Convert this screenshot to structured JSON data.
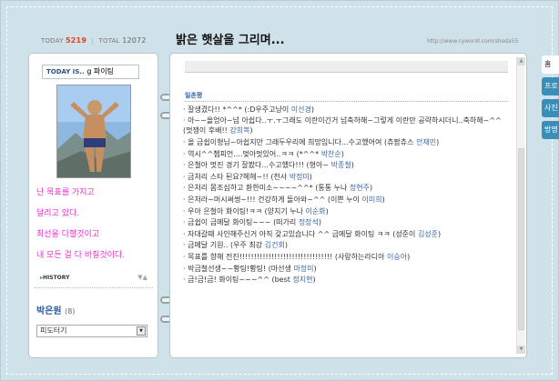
{
  "header": {
    "today_label": "TODAY",
    "today_count": "5219",
    "total_label": "TOTAL",
    "total_count": "12072",
    "title": "밝은 햇살을 그리며...",
    "url": "http://www.cyworld.com/shoda55"
  },
  "left": {
    "today_is_label": "TODAY IS..",
    "today_is_value": "g 파이팅",
    "bio": [
      "난 목표를 가지고",
      "달리고 있다.",
      "최선을 다할것이고",
      "내 모든 걸 다 바칠것이다."
    ],
    "history_label": "HISTORY",
    "history_arrows": "▼▲",
    "owner_name": "박은원",
    "owner_count": "(8)",
    "select_value": "피도터기",
    "select_arrow": "▼"
  },
  "main": {
    "section_title": "일촌평",
    "comments": [
      {
        "text": "· 잘생겼다!! *^^* (:D우주고냥이 ",
        "author": "이선경",
        "tail": ")"
      },
      {
        "text": "· 아~~올엉아~넘 아쉽다..ㅜ.ㅜ그래도 이란이긴거 넘축하해~그렇게 이란만 공략하시더니..축하해~^^ (멋쟁이 후배!! ",
        "author": "강희복",
        "tail": ")"
      },
      {
        "text": "· 올 금쉽이형님~아쉽지만 그래두우리에 희망입니다...수고했어여 (츄팝츄스 ",
        "author": "안재민",
        "tail": ")"
      },
      {
        "text": "· 역시^^챔피언....멎아멋있어..ㅋㅋ (*^^* ",
        "author": "박찬순",
        "tail": ")"
      },
      {
        "text": "· 은철아 멋진 경기 잘봤다...수고했다!!! (형아~ ",
        "author": "박종철",
        "tail": ")"
      },
      {
        "text": "· 금처리 스타 된요?헤헤~!! (천사 ",
        "author": "박정미",
        "tail": ")"
      },
      {
        "text": "· 은처리 몸조심하고 환한미소~~~~^^* (통통 누나 ",
        "author": "정현주",
        "tail": ")"
      },
      {
        "text": "· 은처라~머시써썽~!!! 건강하게 돌아와~^^ (이쁜 누이 ",
        "author": "이미희",
        "tail": ")"
      },
      {
        "text": "· 우아 은철아 화이팅!ㅋㅋ (양치기 누나 ",
        "author": "이순화",
        "tail": ")"
      },
      {
        "text": "· 금쉽이 금메달 화이팅~~~ (떠가리 ",
        "author": "정장석",
        "tail": ")"
      },
      {
        "text": "· 자대갈때 사인해주신거 아직 갖고있습니다 ^^ 금메달 화이팅 ㅋㅋ (성준이 ",
        "author": "김성준",
        "tail": ")"
      },
      {
        "text": "· 금메달 기원.. (우주 최강 ",
        "author": "김건회",
        "tail": ")"
      },
      {
        "text": "· 목표를 향해 전진!!!!!!!!!!!!!!!!!!!!!!!!!!!!!!!! (사랑하는라디아 ",
        "author": "이승아",
        "tail": ")"
      },
      {
        "text": "· 박금철선생~~황팅!황팅! (마선생 ",
        "author": "마정미",
        "tail": ")"
      },
      {
        "text": "· 금!금!금! 화이팅~~~^^ (best ",
        "author": "정지현",
        "tail": ")"
      }
    ]
  },
  "tabs": [
    "홈",
    "프로",
    "사진",
    "방명"
  ],
  "colors": {
    "frame": "#cfe2ea",
    "tab": "#3a8fb8",
    "bio_text": "#ee2ad0",
    "link": "#3b66a8"
  }
}
